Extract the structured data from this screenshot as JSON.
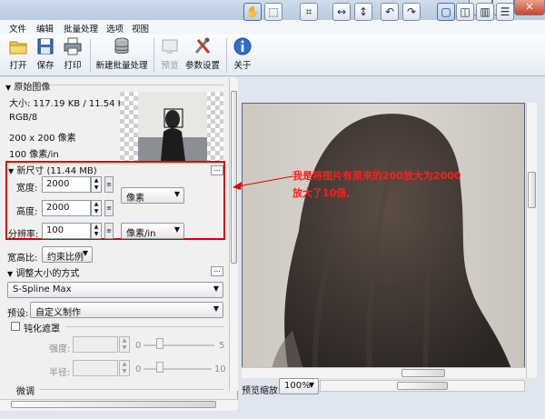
{
  "menu": [
    "文件",
    "编辑",
    "批量处理",
    "选项",
    "视图"
  ],
  "window_controls": {
    "min": "—",
    "max": "□",
    "close": "✕"
  },
  "toolbar": {
    "open": "打开",
    "save": "保存",
    "print": "打印",
    "new_batch": "新建批量处理",
    "preview": "预览",
    "params": "参数设置",
    "about": "关于"
  },
  "original": {
    "header": "原始图像",
    "size": "大小: 117.19 KB / 11.54 KB",
    "mode": "RGB/8",
    "dims": "200 x 200 像素",
    "res": "100 像素/in"
  },
  "new_size": {
    "header": "新尺寸 (11.44 MB)",
    "width_label": "宽度:",
    "width": "2000",
    "height_label": "高度:",
    "height": "2000",
    "res_label": "分辨率:",
    "res": "100",
    "unit": "像素",
    "res_unit": "像素/in",
    "dots": "..."
  },
  "aspect": {
    "label": "宽高比:",
    "value": "约束比例"
  },
  "resize": {
    "header": "调整大小的方式",
    "method": "S-Spline Max",
    "preset_label": "预设:",
    "preset": "自定义制作"
  },
  "sharpen": {
    "label": "钝化遮罩",
    "strength_label": "强度:",
    "strength_min": "0",
    "strength_max": "5",
    "radius_label": "半径:",
    "radius_min": "0",
    "radius_max": "10"
  },
  "fine": {
    "label": "微调"
  },
  "annotation": {
    "line1": "我是将图片有原来的200放大为2000",
    "line2": "放大了10倍,"
  },
  "zoom": {
    "label": "预览缩放:",
    "value": "100%"
  },
  "icons": {
    "open": "folder-icon",
    "save": "floppy-icon",
    "print": "printer-icon",
    "batch": "database-icon",
    "preview": "preview-icon",
    "params": "tools-icon",
    "about": "info-icon"
  }
}
